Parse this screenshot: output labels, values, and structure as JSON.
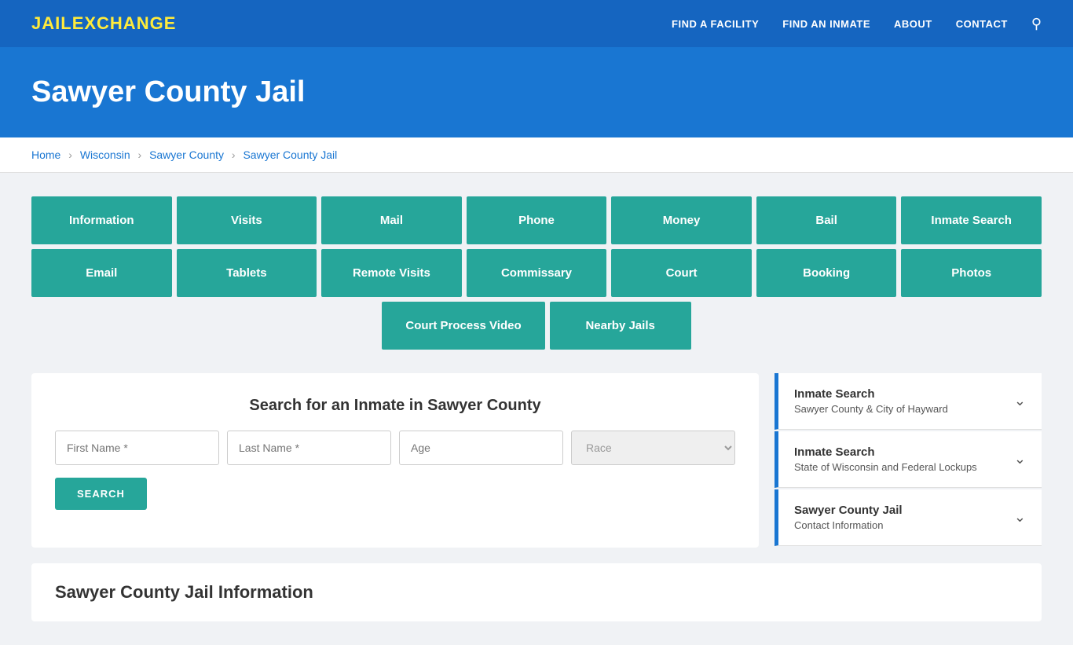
{
  "nav": {
    "logo_jail": "JAIL",
    "logo_exchange": "EXCHANGE",
    "links": [
      {
        "label": "FIND A FACILITY",
        "name": "find-facility-link"
      },
      {
        "label": "FIND AN INMATE",
        "name": "find-inmate-link"
      },
      {
        "label": "ABOUT",
        "name": "about-link"
      },
      {
        "label": "CONTACT",
        "name": "contact-link"
      }
    ]
  },
  "hero": {
    "title": "Sawyer County Jail"
  },
  "breadcrumb": {
    "home": "Home",
    "wisconsin": "Wisconsin",
    "county": "Sawyer County",
    "jail": "Sawyer County Jail"
  },
  "buttons_row1": [
    "Information",
    "Visits",
    "Mail",
    "Phone",
    "Money",
    "Bail",
    "Inmate Search"
  ],
  "buttons_row2": [
    "Email",
    "Tablets",
    "Remote Visits",
    "Commissary",
    "Court",
    "Booking",
    "Photos"
  ],
  "buttons_row3": [
    "Court Process Video",
    "Nearby Jails"
  ],
  "search": {
    "title": "Search for an Inmate in Sawyer County",
    "first_name_placeholder": "First Name *",
    "last_name_placeholder": "Last Name *",
    "age_placeholder": "Age",
    "race_placeholder": "Race",
    "button_label": "SEARCH"
  },
  "sidebar": {
    "items": [
      {
        "title": "Inmate Search",
        "subtitle": "Sawyer County & City of Hayward",
        "name": "inmate-search-sawyer"
      },
      {
        "title": "Inmate Search",
        "subtitle": "State of Wisconsin and Federal Lockups",
        "name": "inmate-search-wisconsin"
      },
      {
        "title": "Sawyer County Jail",
        "subtitle": "Contact Information",
        "name": "contact-information"
      }
    ]
  },
  "bottom": {
    "title": "Sawyer County Jail Information"
  }
}
